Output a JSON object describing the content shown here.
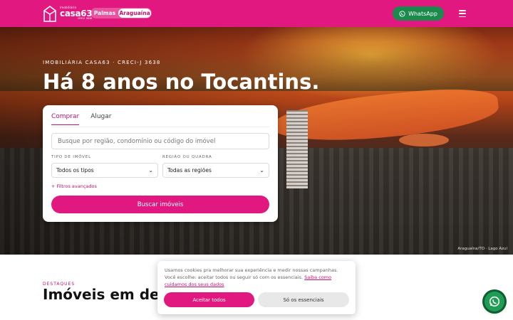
{
  "header": {
    "logo": {
      "small": "imobiliária",
      "main": "casa63",
      "creci": "CRECI 3638"
    },
    "cities": [
      "Palmas",
      "Araguaína"
    ],
    "active_city": "Araguaína",
    "whatsapp_label": "WhatsApp"
  },
  "hero": {
    "eyebrow": "IMOBILIÁRIA CASA63 · CRECI-J 3638",
    "title": "Há 8 anos no Tocantins.",
    "photo_credit": "Araguaína/TO · Lago Azul"
  },
  "search": {
    "tabs": [
      "Comprar",
      "Alugar"
    ],
    "active_tab": "Comprar",
    "input_placeholder": "Busque por região, condomínio ou código do imóvel",
    "type_label": "TIPO DE IMÓVEL",
    "type_value": "Todos os tipos",
    "region_label": "REGIÃO OU QUADRA",
    "region_value": "Todas as regiões",
    "advanced_link": "+ Filtros avançados",
    "submit_label": "Buscar imóveis"
  },
  "featured": {
    "eyebrow": "DESTAQUES",
    "title": "Imóveis em des"
  },
  "cookie": {
    "text": "Usamos cookies pra melhorar sua experiência e medir nossas campanhas. Você escolhe: aceitar todos ou seguir só com os essenciais.",
    "link": "Saiba como cuidamos dos seus dados",
    "accept_label": "Aceitar todos",
    "essential_label": "Só os essenciais"
  },
  "colors": {
    "brand": "#e0187f",
    "whatsapp": "#1b8a4d"
  }
}
